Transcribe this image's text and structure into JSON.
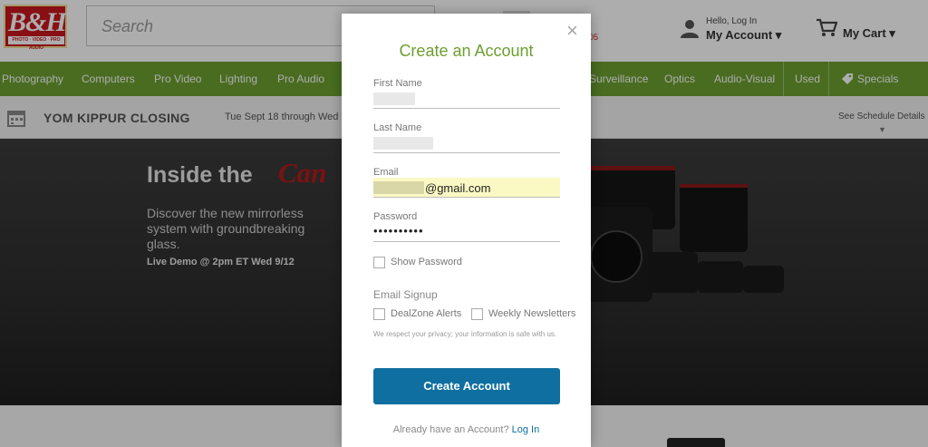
{
  "header": {
    "logo_text": "B&H",
    "logo_tagline": "PHOTO · VIDEO · PRO AUDIO",
    "search_placeholder": "Search",
    "partial_text": "05",
    "account_greeting": "Hello, Log In",
    "account_label": "My Account ▾",
    "cart_label": "My Cart ▾"
  },
  "nav": {
    "items": [
      "Photography",
      "Computers",
      "Pro Video",
      "Lighting",
      "Pro Audio",
      "Surveillance",
      "Optics",
      "Audio-Visual",
      "Used",
      "Specials"
    ]
  },
  "banner": {
    "title": "YOM KIPPUR CLOSING",
    "dates": "Tue Sept 18 through Wed",
    "schedule_link": "See Schedule Details",
    "chevron": "▼"
  },
  "hero": {
    "heading": "Inside the",
    "brand": "Can",
    "description": "Discover the new mirrorless system with groundbreaking glass.",
    "demo": "Live Demo @ 2pm ET Wed 9/12"
  },
  "modal": {
    "close": "×",
    "title": "Create an Account",
    "fields": {
      "first_name_label": "First Name",
      "last_name_label": "Last Name",
      "email_label": "Email",
      "email_value": "@gmail.com",
      "password_label": "Password",
      "password_value": "••••••••••"
    },
    "show_password": "Show Password",
    "email_signup": "Email Signup",
    "dealzone": "DealZone Alerts",
    "newsletters": "Weekly Newsletters",
    "privacy": "We respect your privacy; your information is safe with us.",
    "submit": "Create Account",
    "login_prompt": "Already have an Account?",
    "login_link": "Log In"
  },
  "colors": {
    "nav_green": "#6c9f30",
    "brand_red": "#c9171e",
    "button_blue": "#0f6fa1",
    "email_highlight": "#fbf9c3"
  }
}
